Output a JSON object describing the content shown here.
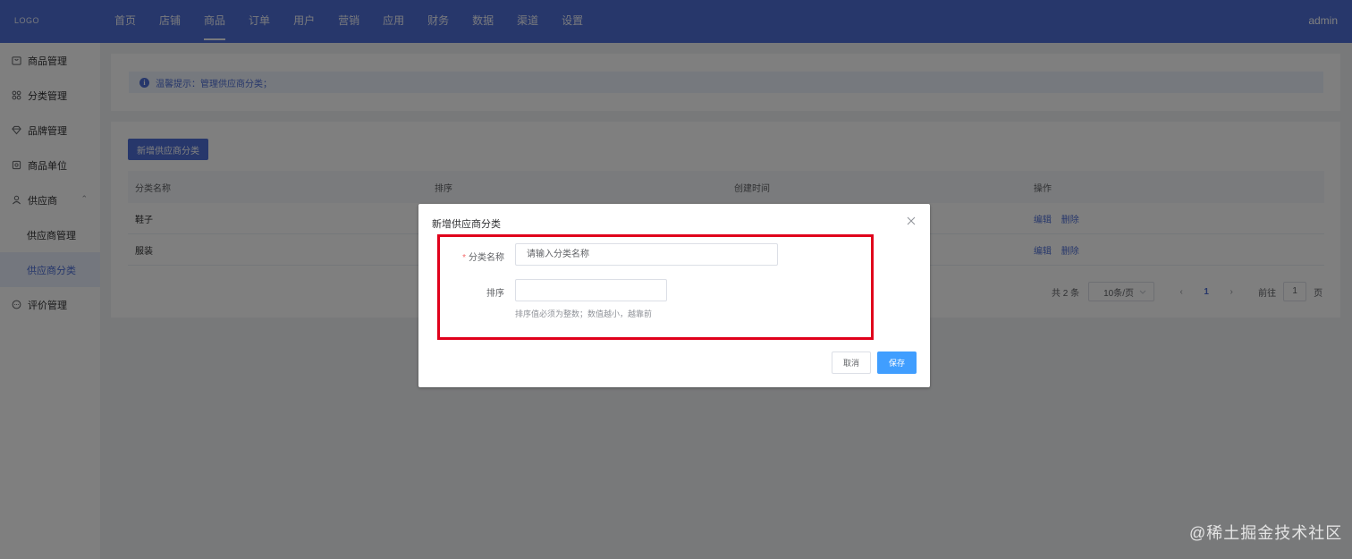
{
  "header": {
    "logo": "LOGO",
    "nav": [
      "首页",
      "店铺",
      "商品",
      "订单",
      "用户",
      "营销",
      "应用",
      "财务",
      "数据",
      "渠道",
      "设置"
    ],
    "active_index": 2,
    "user": "admin"
  },
  "sidebar": {
    "items": [
      {
        "label": "商品管理",
        "icon": "bag-icon"
      },
      {
        "label": "分类管理",
        "icon": "grid-icon"
      },
      {
        "label": "品牌管理",
        "icon": "diamond-icon"
      },
      {
        "label": "商品单位",
        "icon": "box-icon"
      },
      {
        "label": "供应商",
        "icon": "user-icon",
        "expanded": true,
        "arrow": "⌃",
        "children": [
          {
            "label": "供应商管理",
            "active": false
          },
          {
            "label": "供应商分类",
            "active": true
          }
        ]
      },
      {
        "label": "评价管理",
        "icon": "chat-icon"
      }
    ]
  },
  "tip": {
    "icon_text": "i",
    "text": "温馨提示：管理供应商分类；"
  },
  "toolbar": {
    "add_label": "新增供应商分类"
  },
  "table": {
    "headers": [
      "分类名称",
      "排序",
      "创建时间",
      "操作"
    ],
    "rows": [
      {
        "name": "鞋子",
        "sort": "",
        "created": "",
        "edit": "编辑",
        "delete": "删除"
      },
      {
        "name": "服装",
        "sort": "",
        "created": "",
        "edit": "编辑",
        "delete": "删除"
      }
    ]
  },
  "pagination": {
    "total": "共 2 条",
    "page_size": "10条/页",
    "prev": "‹",
    "current": "1",
    "next": "›",
    "goto_label": "前往",
    "goto_value": "1",
    "page_suffix": "页"
  },
  "dialog": {
    "title": "新增供应商分类",
    "field_name_label": "分类名称",
    "field_name_required": "*",
    "field_name_placeholder": "请输入分类名称",
    "field_sort_label": "排序",
    "field_sort_value": "",
    "sort_hint": "排序值必须为整数；数值越小，越靠前",
    "cancel_label": "取消",
    "save_label": "保存",
    "highlight_color": "#e0001b"
  },
  "watermark": "@稀土掘金技术社区",
  "colors": {
    "primary": "#4e6fd7",
    "save_button": "#409eff"
  }
}
